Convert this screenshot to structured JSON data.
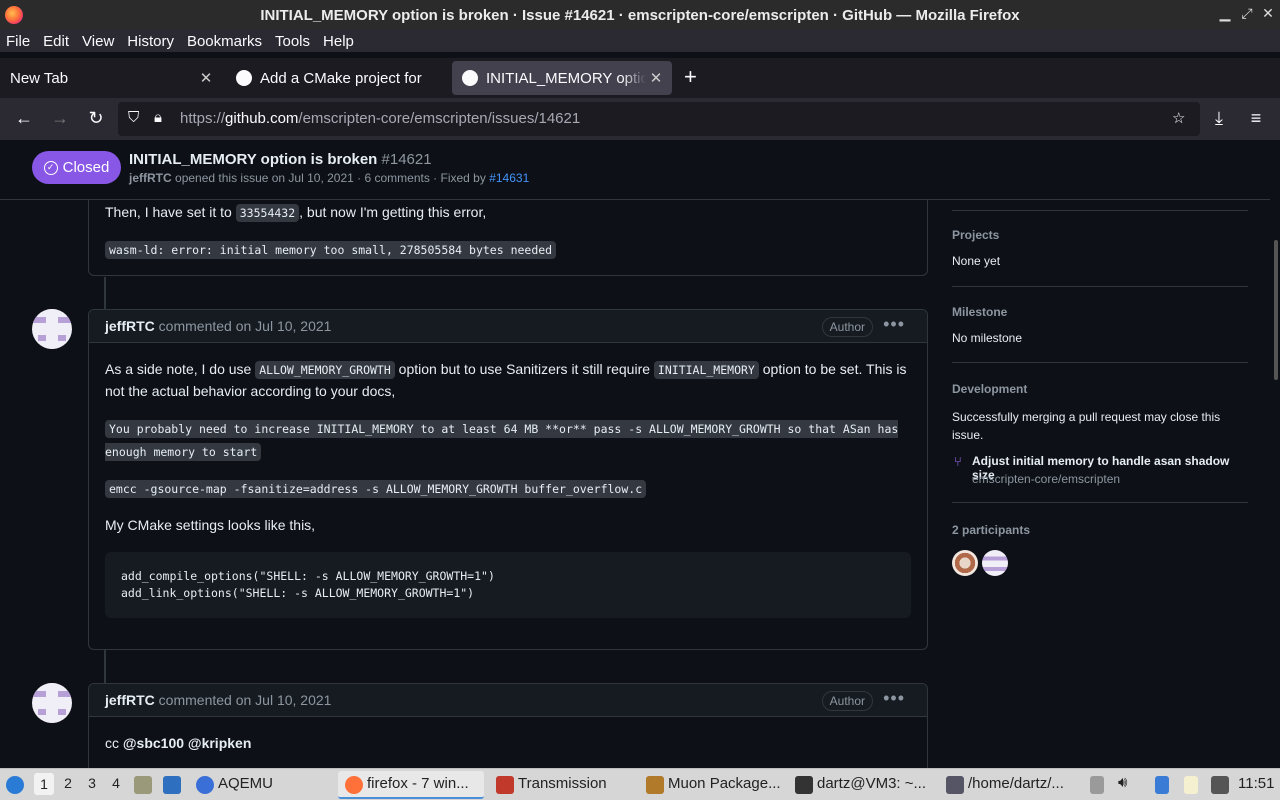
{
  "window": {
    "title": "INITIAL_MEMORY option is broken · Issue #14621 · emscripten-core/emscripten · GitHub — Mozilla Firefox"
  },
  "menu": [
    "File",
    "Edit",
    "View",
    "History",
    "Bookmarks",
    "Tools",
    "Help"
  ],
  "tabs": [
    {
      "label": "New Tab"
    },
    {
      "label": "Add a CMake project for"
    },
    {
      "label": "INITIAL_MEMORY option is broken"
    }
  ],
  "url": {
    "prefix": "https://",
    "domain": "github.com",
    "path": "/emscripten-core/emscripten/issues/14621"
  },
  "issue": {
    "state": "Closed",
    "title": "INITIAL_MEMORY option is broken",
    "number": "#14621",
    "author": "jeffRTC",
    "meta": "opened this issue on Jul 10, 2021 · 6 comments · Fixed by",
    "fixed_by": "#14631"
  },
  "comments": {
    "top": {
      "text1": "Then, I have set it to",
      "code1": "33554432",
      "text2": ", but now I'm getting this error,",
      "code2": "wasm-ld: error: initial memory too small, 278505584 bytes needed"
    },
    "c2": {
      "author": "jeffRTC",
      "action": "commented on Jul 10, 2021",
      "badge": "Author",
      "p1a": "As a side note, I do use",
      "p1code1": "ALLOW_MEMORY_GROWTH",
      "p1b": "option but to use Sanitizers it still require",
      "p1code2": "INITIAL_MEMORY",
      "p1c": "option to be set. This is not the actual behavior according to your docs,",
      "code_a": "You probably need to increase INITIAL_MEMORY to at least 64 MB **or** pass -s ALLOW_MEMORY_GROWTH so that ASan has enough memory to start",
      "code_b": "emcc -gsource-map -fsanitize=address -s ALLOW_MEMORY_GROWTH buffer_overflow.c",
      "p2": "My CMake settings looks like this,",
      "block": "add_compile_options(\"SHELL: -s ALLOW_MEMORY_GROWTH=1\")\nadd_link_options(\"SHELL: -s ALLOW_MEMORY_GROWTH=1\")"
    },
    "c3": {
      "author": "jeffRTC",
      "action": "commented on Jul 10, 2021",
      "badge": "Author",
      "text": "cc",
      "mention1": "@sbc100",
      "mention2": "@kripken"
    }
  },
  "sidebar": {
    "projects_h": "Projects",
    "projects_v": "None yet",
    "milestone_h": "Milestone",
    "milestone_v": "No milestone",
    "dev_h": "Development",
    "dev_v": "Successfully merging a pull request may close this issue.",
    "pr_title": "Adjust initial memory to handle asan shadow size",
    "pr_repo": "emscripten-core/emscripten",
    "participants_h": "2 participants"
  },
  "taskbar": {
    "workspaces": [
      "1",
      "2",
      "3",
      "4"
    ],
    "items": [
      "AQEMU",
      "firefox - 7 win...",
      "Transmission",
      "Muon Package...",
      "dartz@VM3: ~...",
      "/home/dartz/..."
    ],
    "clock": "11:51"
  }
}
